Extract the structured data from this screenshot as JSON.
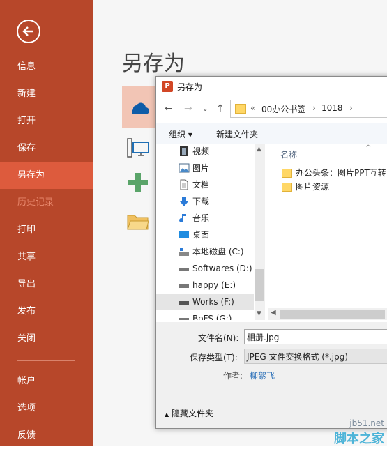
{
  "sidebar": {
    "items": [
      {
        "label": "信息"
      },
      {
        "label": "新建"
      },
      {
        "label": "打开"
      },
      {
        "label": "保存"
      },
      {
        "label": "另存为"
      },
      {
        "label": "历史记录"
      },
      {
        "label": "打印"
      },
      {
        "label": "共享"
      },
      {
        "label": "导出"
      },
      {
        "label": "发布"
      },
      {
        "label": "关闭"
      },
      {
        "label": "帐户"
      },
      {
        "label": "选项"
      },
      {
        "label": "反馈"
      }
    ],
    "accent": "#b7472a",
    "active_color": "#dd5b3d"
  },
  "main": {
    "title": "另存为"
  },
  "dialog": {
    "title": "另存为",
    "breadcrumb": {
      "prefix": "«",
      "folder": "00办公书签",
      "sub": "1018"
    },
    "toolbar": {
      "organize": "组织 ▾",
      "new_folder": "新建文件夹"
    },
    "tree": [
      {
        "label": "视频"
      },
      {
        "label": "图片"
      },
      {
        "label": "文档"
      },
      {
        "label": "下载"
      },
      {
        "label": "音乐"
      },
      {
        "label": "桌面"
      },
      {
        "label": "本地磁盘 (C:)"
      },
      {
        "label": "Softwares (D:)"
      },
      {
        "label": "happy (E:)"
      },
      {
        "label": "Works (F:)"
      },
      {
        "label": "BoFS (G:)"
      }
    ],
    "column_name": "名称",
    "files": [
      {
        "label": "办公头条：图片PPT互转"
      },
      {
        "label": "图片资源"
      }
    ],
    "filename_label": "文件名(N):",
    "filename_value": "相册.jpg",
    "filetype_label": "保存类型(T):",
    "filetype_value": "JPEG 文件交换格式 (*.jpg)",
    "author_label": "作者:",
    "author_value": "柳絮飞",
    "hide_folders": "隐藏文件夹"
  },
  "watermark": {
    "line1": "jb51.net",
    "line2": "脚本之家"
  }
}
